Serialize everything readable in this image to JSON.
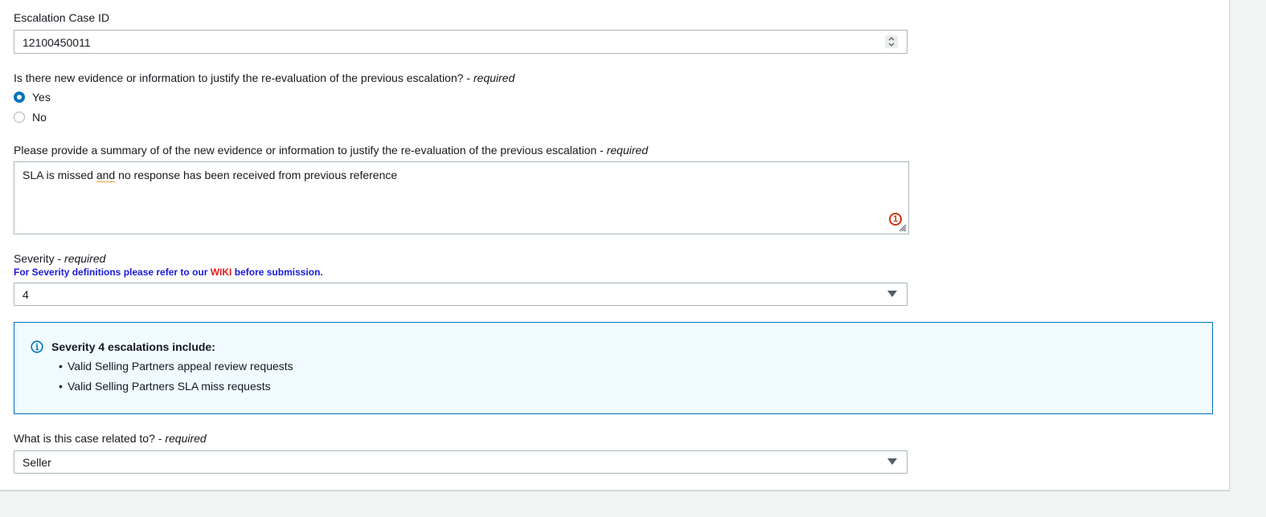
{
  "case_id": {
    "label": "Escalation Case ID",
    "value": "12100450011"
  },
  "new_evidence": {
    "question": "Is there new evidence or information to justify the re-evaluation of the previous escalation?",
    "required_marker": "required",
    "options": [
      {
        "label": "Yes",
        "checked": true
      },
      {
        "label": "No",
        "checked": false
      }
    ]
  },
  "summary": {
    "label": "Please provide a summary of of the new evidence or information to justify the re-evaluation of the previous escalation",
    "required_marker": "required",
    "value_before": "SLA is missed ",
    "value_flagged": "and",
    "value_after": " no response has been received from previous reference",
    "issue_count": "1"
  },
  "severity": {
    "label": "Severity",
    "required_marker": "required",
    "hint_before": "For Severity definitions please refer to our ",
    "hint_link": "WIKI",
    "hint_after": " before submission.",
    "value": "4"
  },
  "severity_info": {
    "title": "Severity 4 escalations include:",
    "items": [
      "Valid Selling Partners appeal review requests",
      "Valid Selling Partners SLA miss requests"
    ]
  },
  "related_to": {
    "label": "What is this case related to?",
    "required_marker": "required",
    "value": "Seller"
  },
  "colors": {
    "accent": "#0073bb",
    "error": "#d13212",
    "hint": "#1a1adb",
    "wiki": "#e41d1d",
    "info_bg": "#f1faff"
  }
}
